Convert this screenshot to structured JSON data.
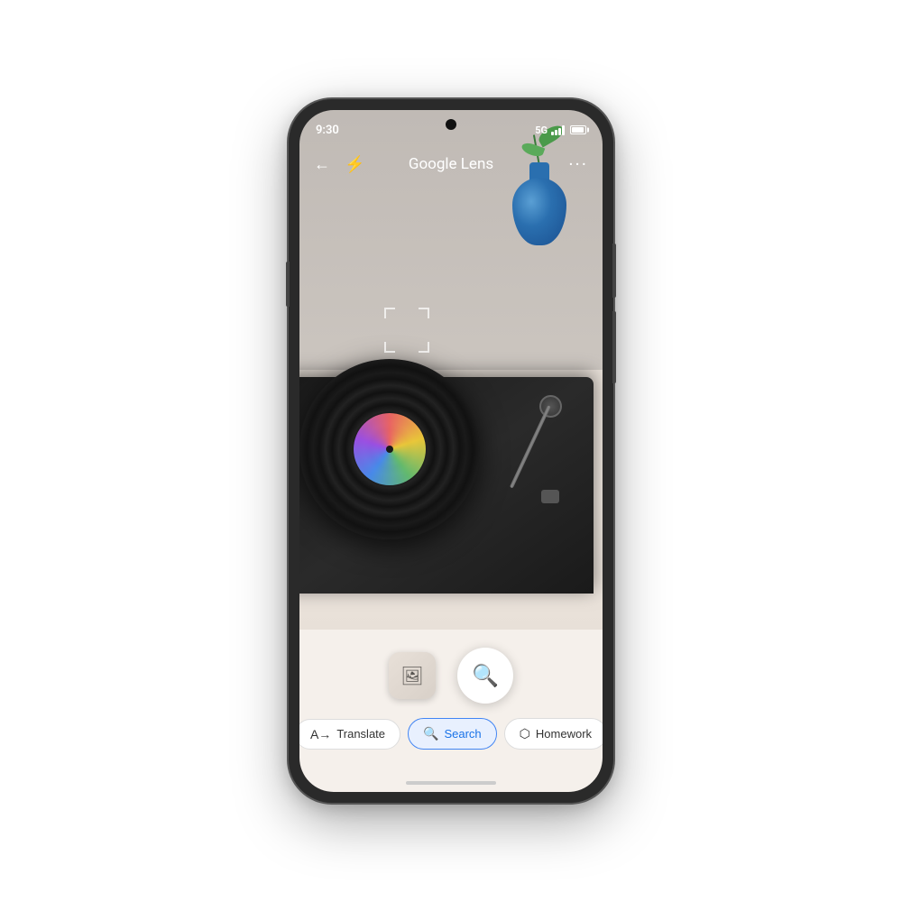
{
  "phone": {
    "status_bar": {
      "time": "9:30",
      "network": "5G"
    },
    "nav": {
      "title": "Google Lens",
      "back_icon": "←",
      "flash_icon": "⚡",
      "more_icon": "···"
    },
    "bottom": {
      "tabs": [
        {
          "id": "translate",
          "label": "Translate",
          "icon": "A→",
          "active": false
        },
        {
          "id": "search",
          "label": "Search",
          "icon": "🔍",
          "active": true
        },
        {
          "id": "homework",
          "label": "Homework",
          "icon": "⬡",
          "active": false
        }
      ],
      "home_indicator": ""
    }
  }
}
